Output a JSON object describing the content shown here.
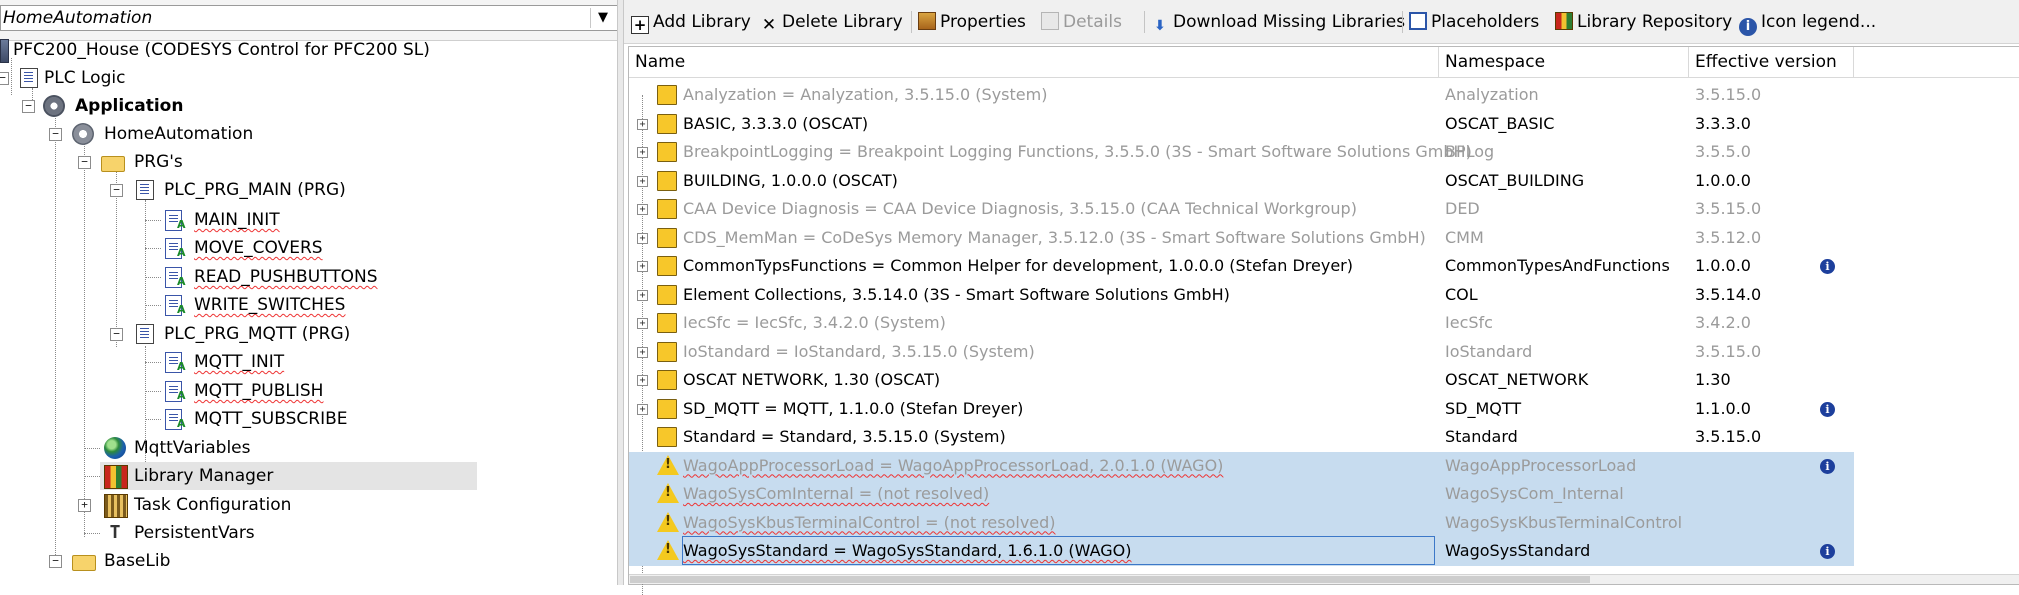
{
  "tree": {
    "combo_value": "HomeAutomation",
    "items": [
      {
        "label": "PFC200_House (CODESYS Control for PFC200 SL)"
      },
      {
        "label": "PLC Logic"
      },
      {
        "label": "Application"
      },
      {
        "label": "HomeAutomation"
      },
      {
        "label": "PRG's"
      },
      {
        "label": "PLC_PRG_MAIN (PRG)"
      },
      {
        "label": "MAIN_INIT"
      },
      {
        "label": "MOVE_COVERS"
      },
      {
        "label": "READ_PUSHBUTTONS"
      },
      {
        "label": "WRITE_SWITCHES"
      },
      {
        "label": "PLC_PRG_MQTT (PRG)"
      },
      {
        "label": "MQTT_INIT"
      },
      {
        "label": "MQTT_PUBLISH"
      },
      {
        "label": "MQTT_SUBSCRIBE"
      },
      {
        "label": "MqttVariables"
      },
      {
        "label": "Library Manager"
      },
      {
        "label": "Task Configuration"
      },
      {
        "label": "PersistentVars"
      },
      {
        "label": "BaseLib"
      }
    ]
  },
  "toolbar": {
    "add": "Add Library",
    "delete": "Delete Library",
    "properties": "Properties",
    "details": "Details",
    "download": "Download Missing Libraries",
    "placeholders": "Placeholders",
    "repository": "Library Repository",
    "legend": "Icon legend..."
  },
  "table": {
    "columns": [
      "Name",
      "Namespace",
      "Effective version"
    ],
    "rows": [
      {
        "name": "Analyzation = Analyzation, 3.5.15.0 (System)",
        "namespace": "Analyzation",
        "version": "3.5.15.0"
      },
      {
        "name": "BASIC, 3.3.3.0 (OSCAT)",
        "namespace": "OSCAT_BASIC",
        "version": "3.3.3.0"
      },
      {
        "name": "BreakpointLogging = Breakpoint Logging Functions, 3.5.5.0 (3S - Smart Software Solutions GmbH)",
        "namespace": "BPLog",
        "version": "3.5.5.0"
      },
      {
        "name": "BUILDING, 1.0.0.0 (OSCAT)",
        "namespace": "OSCAT_BUILDING",
        "version": "1.0.0.0"
      },
      {
        "name": "CAA Device Diagnosis = CAA Device Diagnosis, 3.5.15.0 (CAA Technical Workgroup)",
        "namespace": "DED",
        "version": "3.5.15.0"
      },
      {
        "name": "CDS_MemMan = CoDeSys Memory Manager, 3.5.12.0 (3S - Smart Software Solutions GmbH)",
        "namespace": "CMM",
        "version": "3.5.12.0"
      },
      {
        "name": "CommonTypsFunctions = Common Helper for development, 1.0.0.0 (Stefan Dreyer)",
        "namespace": "CommonTypesAndFunctions",
        "version": "1.0.0.0"
      },
      {
        "name": "Element Collections, 3.5.14.0 (3S - Smart Software Solutions GmbH)",
        "namespace": "COL",
        "version": "3.5.14.0"
      },
      {
        "name": "IecSfc = IecSfc, 3.4.2.0 (System)",
        "namespace": "IecSfc",
        "version": "3.4.2.0"
      },
      {
        "name": "IoStandard = IoStandard, 3.5.15.0 (System)",
        "namespace": "IoStandard",
        "version": "3.5.15.0"
      },
      {
        "name": "OSCAT NETWORK, 1.30 (OSCAT)",
        "namespace": "OSCAT_NETWORK",
        "version": "1.30"
      },
      {
        "name": "SD_MQTT = MQTT, 1.1.0.0 (Stefan Dreyer)",
        "namespace": "SD_MQTT",
        "version": "1.1.0.0"
      },
      {
        "name": "Standard = Standard, 3.5.15.0 (System)",
        "namespace": "Standard",
        "version": "3.5.15.0"
      },
      {
        "name": "WagoAppProcessorLoad = WagoAppProcessorLoad, 2.0.1.0 (WAGO)",
        "namespace": "WagoAppProcessorLoad",
        "version": ""
      },
      {
        "name": "WagoSysComInternal = (not resolved)",
        "namespace": "WagoSysCom_Internal",
        "version": ""
      },
      {
        "name": "WagoSysKbusTerminalControl = (not resolved)",
        "namespace": "WagoSysKbusTerminalControl",
        "version": ""
      },
      {
        "name": "WagoSysStandard = WagoSysStandard, 1.6.1.0 (WAGO)",
        "namespace": "WagoSysStandard",
        "version": ""
      }
    ]
  },
  "colors": {
    "selection": "#c7dcef",
    "faded_text": "#9b9b9b",
    "library_icon": "#f7c72a",
    "info_icon": "#1d3f9c"
  }
}
